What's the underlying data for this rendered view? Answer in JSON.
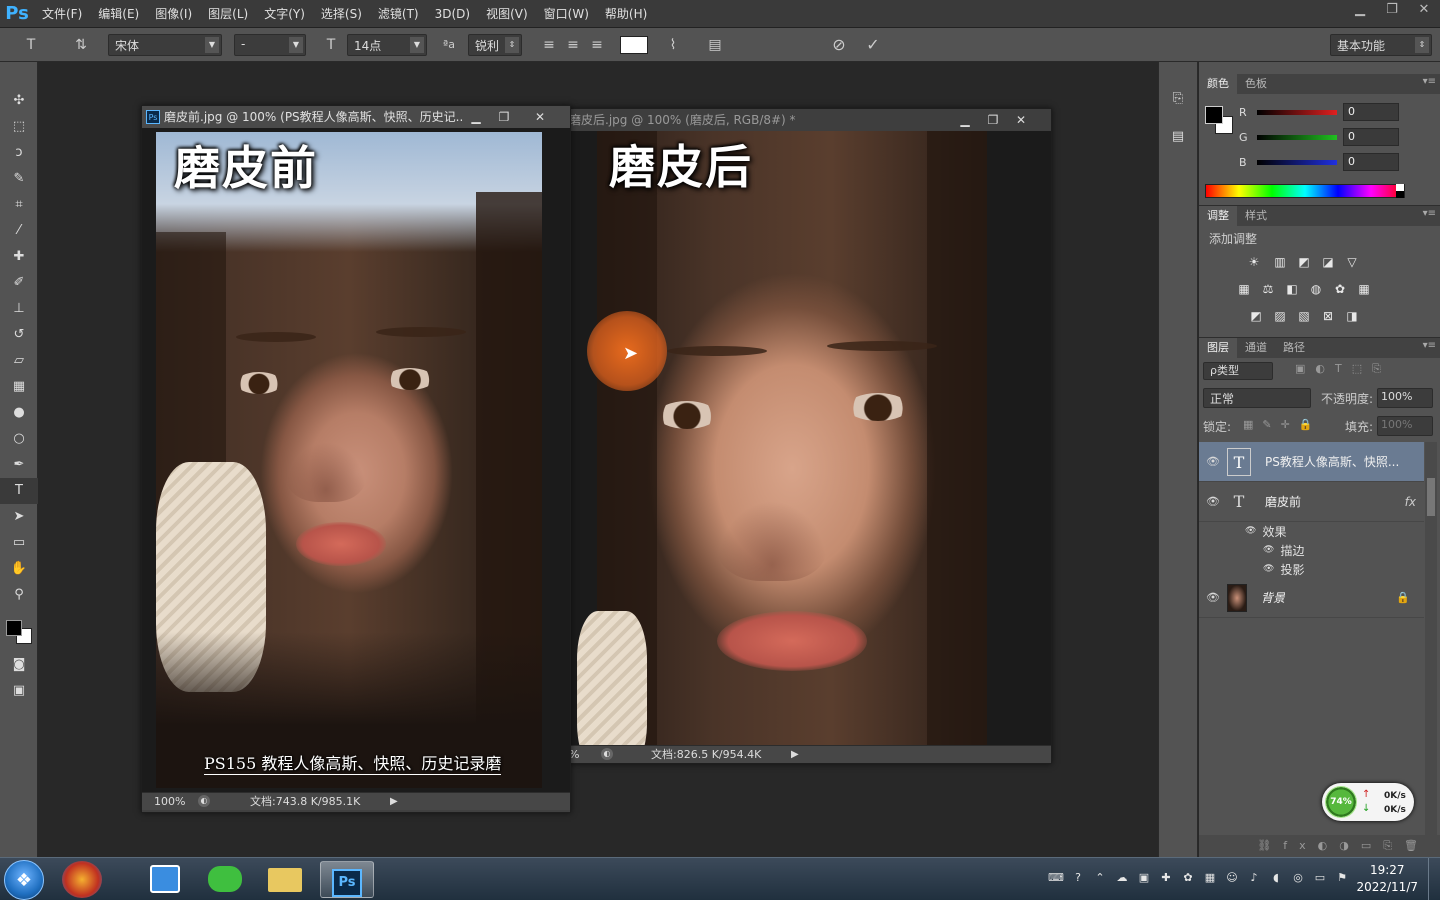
{
  "menubar": {
    "logo": "Ps",
    "items": [
      "文件(F)",
      "编辑(E)",
      "图像(I)",
      "图层(L)",
      "文字(Y)",
      "选择(S)",
      "滤镜(T)",
      "3D(D)",
      "视图(V)",
      "窗口(W)",
      "帮助(H)"
    ],
    "win_controls": [
      "▁",
      "❐",
      "✕"
    ]
  },
  "options": {
    "font_family": "宋体",
    "font_style": "-",
    "font_size": "14点",
    "aa_label": "ªa",
    "antialias": "锐利",
    "workspace": "基本功能"
  },
  "doc_before": {
    "title": "磨皮前.jpg @ 100% (PS教程人像高斯、快照、历史记...",
    "overlay_title": "磨皮前",
    "caption": "PS155 教程人像高斯、快照、历史记录磨",
    "zoom": "100%",
    "doc_size": "文档:743.8 K/985.1K"
  },
  "doc_after": {
    "title": "磨皮后.jpg @ 100% (磨皮后, RGB/8#) *",
    "overlay_title": "磨皮后",
    "zoom": "%",
    "doc_size": "文档:826.5 K/954.4K"
  },
  "color_panel": {
    "tabs": [
      "颜色",
      "色板"
    ],
    "channels": [
      {
        "label": "R",
        "value": "0",
        "color": "#d02020"
      },
      {
        "label": "G",
        "value": "0",
        "color": "#20b020"
      },
      {
        "label": "B",
        "value": "0",
        "color": "#2030d0"
      }
    ]
  },
  "adjust_panel": {
    "tabs": [
      "调整",
      "样式"
    ],
    "heading": "添加调整"
  },
  "layers_panel": {
    "tabs": [
      "图层",
      "通道",
      "路径"
    ],
    "filter": "ρ类型",
    "blend_mode": "正常",
    "opacity_label": "不透明度:",
    "opacity": "100%",
    "lock_label": "锁定:",
    "fill_label": "填充:",
    "fill": "100%",
    "layers": [
      {
        "name": "PS教程人像高斯、快照..."
      },
      {
        "name": "磨皮前",
        "fx": "fx"
      },
      {
        "name": "背景"
      }
    ],
    "effects_label": "效果",
    "effects": [
      "描边",
      "投影"
    ]
  },
  "net_widget": {
    "percent": "74%",
    "up": "0K/s",
    "down": "0K/s"
  },
  "taskbar": {
    "time": "19:27",
    "date": "2022/11/7"
  }
}
